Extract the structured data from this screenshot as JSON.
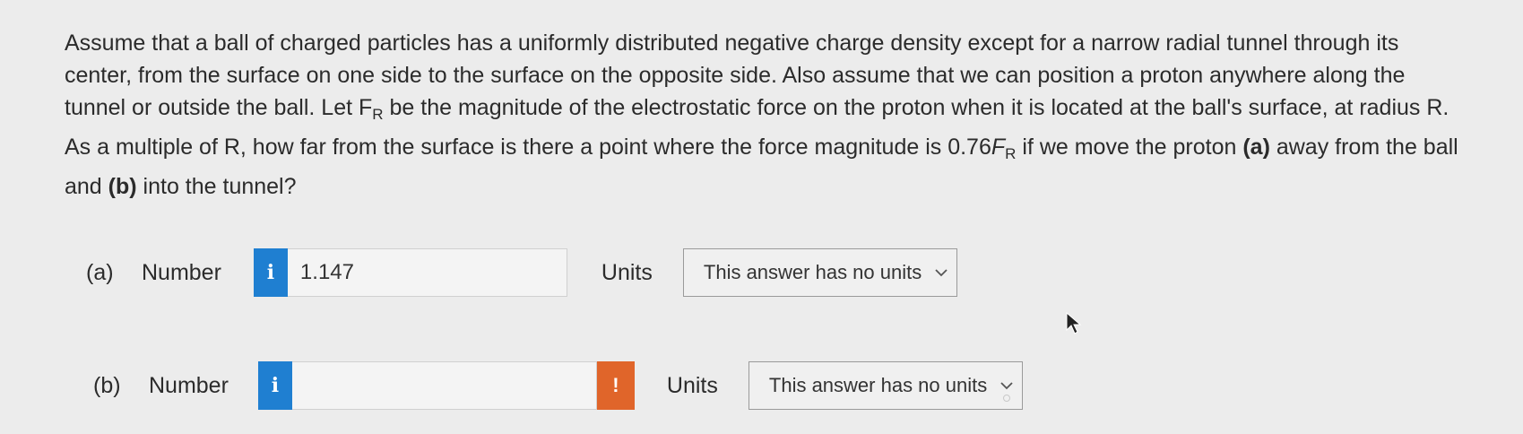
{
  "question": {
    "line1": "Assume that a ball of charged particles has a uniformly distributed negative charge density except for a narrow radial tunnel through its center, from the surface on one side to the surface on the opposite side. Also assume that we can position a proton anywhere along the tunnel or outside the ball. Let ",
    "F": "F",
    "R_sub": "R",
    "line2": " be the magnitude of the electrostatic force on the proton when it is located at the ball's surface, at radius R. As a multiple of R, how far from the surface is there a point where the force magnitude is ",
    "coef": "0.76",
    "F2": "F",
    "R_sub2": "R",
    "line3": " if we move the proton ",
    "a_label": "(a)",
    "line4": " away from the ball and ",
    "b_label": "(b)",
    "line5": " into the tunnel?"
  },
  "part_a": {
    "label": "(a)",
    "number_label": "Number",
    "info_glyph": "i",
    "value": "1.147",
    "units_label": "Units",
    "units_value": "This answer has no units"
  },
  "part_b": {
    "label": "(b)",
    "number_label": "Number",
    "info_glyph": "i",
    "value": "",
    "warn_glyph": "!",
    "units_label": "Units",
    "units_value": "This answer has no units"
  },
  "colors": {
    "info_blue": "#1f7fd1",
    "warn_orange": "#e0652a",
    "background": "#ececec"
  }
}
